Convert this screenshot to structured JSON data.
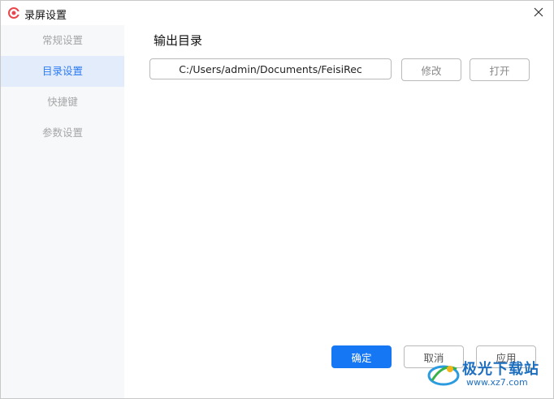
{
  "window": {
    "title": "录屏设置"
  },
  "sidebar": {
    "items": [
      {
        "label": "常规设置",
        "active": false
      },
      {
        "label": "目录设置",
        "active": true
      },
      {
        "label": "快捷键",
        "active": false
      },
      {
        "label": "参数设置",
        "active": false
      }
    ]
  },
  "output": {
    "section_title": "输出目录",
    "path_value": "C:/Users/admin/Documents/FeisiRec",
    "modify_label": "修改",
    "open_label": "打开"
  },
  "footer": {
    "ok_label": "确定",
    "cancel_label": "取消",
    "apply_label": "应用"
  },
  "watermark": {
    "text": "极光下载站",
    "url": "www.xz7.com"
  },
  "colors": {
    "accent": "#1677f5",
    "active_item_bg": "#e2ecfb",
    "active_item_text": "#2d7bf4",
    "app_icon": "#e8474c"
  }
}
